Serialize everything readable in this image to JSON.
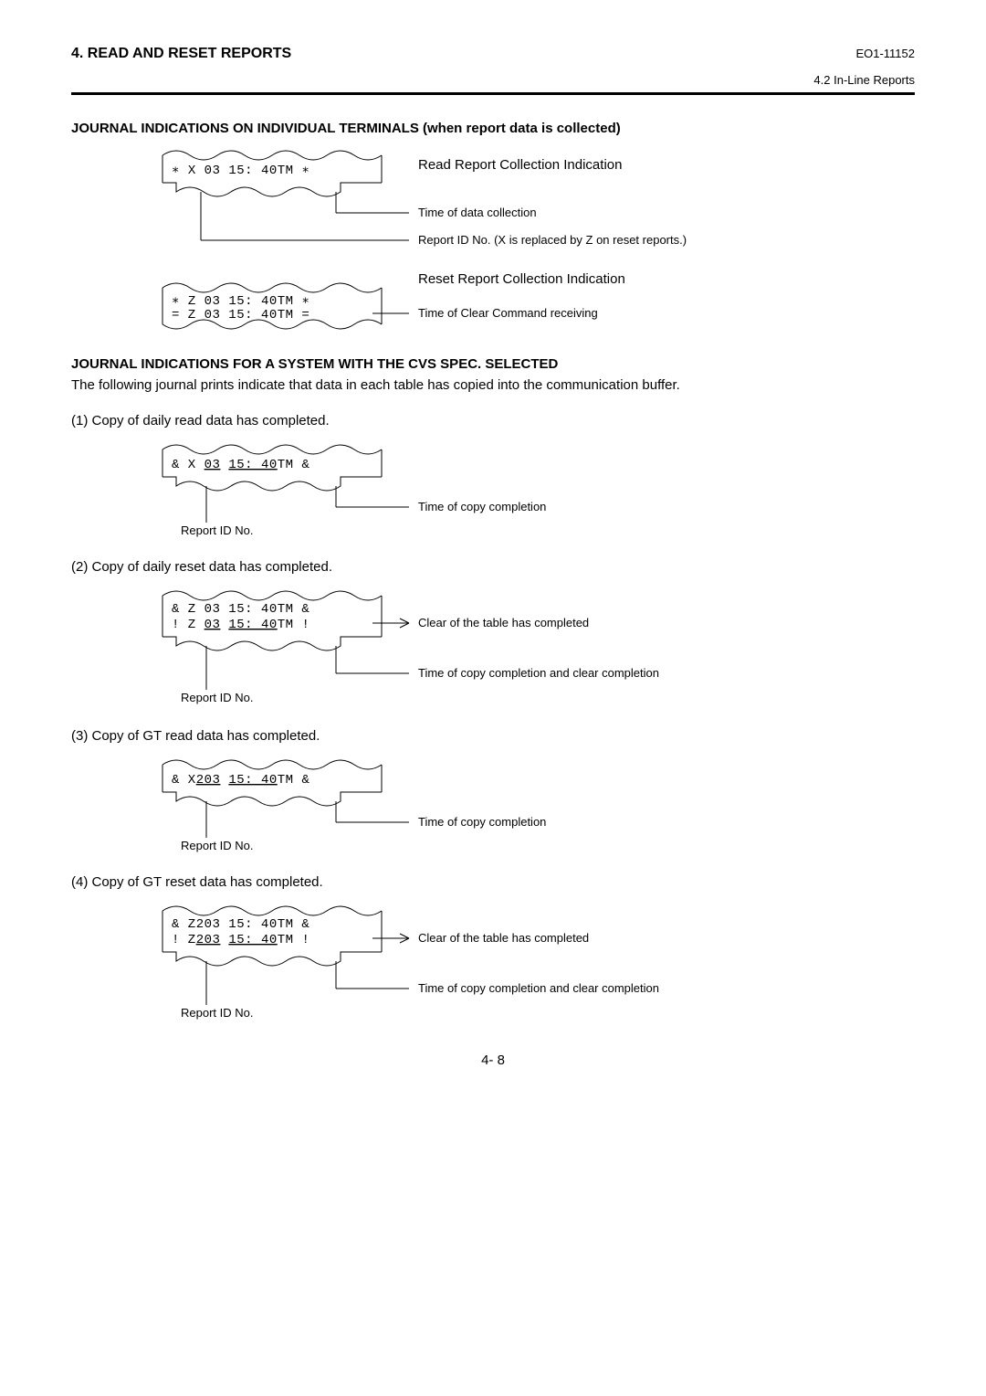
{
  "header": {
    "title": "4. READ AND RESET REPORTS",
    "doc_code": "EO1-11152",
    "sub_header": "4.2 In-Line Reports"
  },
  "section1": {
    "heading": "JOURNAL INDICATIONS ON INDIVIDUAL TERMINALS (when report data is collected)",
    "receipt1_line": "∗  X  03                           15: 40TM ∗",
    "receipt2_line1": "∗  Z  03                           15: 40TM ∗",
    "receipt2_line2": "=  Z  03                            15: 40TM =",
    "ann_read_title": "Read Report Collection Indication",
    "ann_time_data": "Time of data collection",
    "ann_report_id": "Report ID No. (X is replaced by Z on reset reports.)",
    "ann_reset_title": "Reset Report Collection Indication",
    "ann_time_clear": "Time of Clear Command receiving"
  },
  "section2": {
    "heading": "JOURNAL INDICATIONS FOR A SYSTEM WITH THE CVS SPEC. SELECTED",
    "intro": "The following journal prints indicate that data in each table has copied into the communication buffer."
  },
  "items": {
    "i1": {
      "text": "(1) Copy of daily read data has completed.",
      "receipt_left": "&   X",
      "receipt_id": "03",
      "receipt_time": "15: 40",
      "receipt_tm": "TM &",
      "ann1": "Time of copy completion",
      "ann2": "Report ID No."
    },
    "i2": {
      "text": "(2) Copy of daily reset data has completed.",
      "r1": "&   Z  03                           15: 40TM &",
      "r2_left": "!    Z",
      "r2_id": "03",
      "r2_time": "15: 40",
      "r2_tm": "TM !",
      "ann_clear": "Clear of the table has completed",
      "ann_time": "Time of copy completion and clear completion",
      "ann_rep": "Report ID No."
    },
    "i3": {
      "text": "(3) Copy of GT read data has completed.",
      "receipt_left": "&   X",
      "receipt_id": "203",
      "receipt_time": "15: 40",
      "receipt_tm": "TM &",
      "ann1": "Time of copy completion",
      "ann2": "Report ID No."
    },
    "i4": {
      "text": "(4) Copy of GT reset data has completed.",
      "r1": "&   Z203                           15: 40TM &",
      "r2_left": "!    Z",
      "r2_id": "203",
      "r2_time": "15: 40",
      "r2_tm": "TM !",
      "ann_clear": "Clear of the table has completed",
      "ann_time": "Time of copy completion and clear completion",
      "ann_rep": "Report ID No."
    }
  },
  "page_number": "4- 8"
}
